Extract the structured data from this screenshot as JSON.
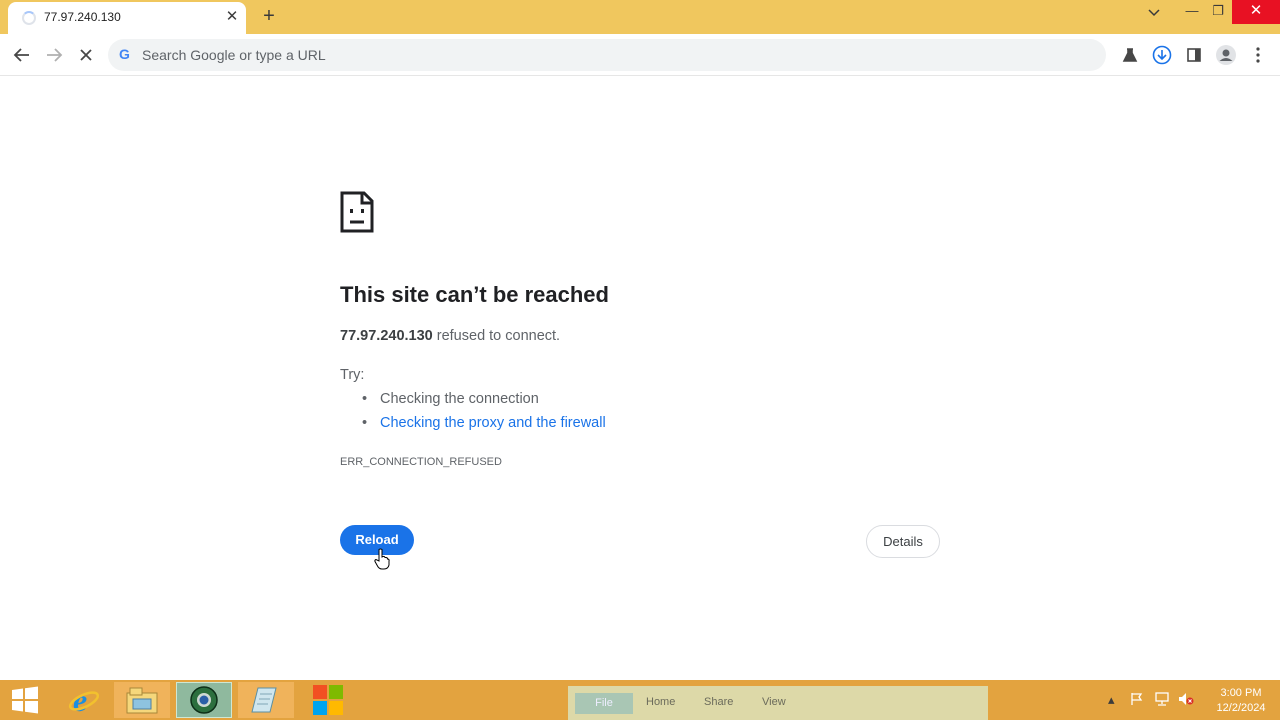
{
  "browser": {
    "tab": {
      "title": "77.97.240.130",
      "close_glyph": "✕"
    },
    "new_tab_glyph": "+",
    "window_controls": {
      "minimize": "—",
      "restore": "❐",
      "close": "✕",
      "dropdown": "⌄"
    },
    "toolbar": {
      "back_icon": "arrow-left-icon",
      "forward_icon": "arrow-right-icon",
      "stop_icon": "stop-icon",
      "omnibox": {
        "placeholder": "Search Google or type a URL",
        "value": "",
        "engine_glyph": "G"
      },
      "right_icons": [
        "extension-icon",
        "download-icon",
        "sidepanel-icon",
        "profile-icon",
        "menu-icon"
      ]
    }
  },
  "error_page": {
    "icon": "sad-document-icon",
    "title": "This site can’t be reached",
    "host": "77.97.240.130",
    "message_suffix": " refused to connect.",
    "try_label": "Try:",
    "suggestions": [
      "Checking the connection",
      "Checking the proxy and the firewall"
    ],
    "error_code": "ERR_CONNECTION_REFUSED",
    "reload_label": "Reload",
    "details_label": "Details",
    "accent_color": "#1a73e8"
  },
  "taskbar": {
    "apps": [
      "windows-logo-icon",
      "internet-explorer-icon",
      "file-explorer-icon",
      "chrome-icon",
      "notepad-icon",
      "microsoft-store-icon"
    ],
    "ribbon_tabs": [
      "File",
      "Home",
      "Share",
      "View"
    ],
    "clock": {
      "time": "3:00 PM",
      "date": "12/2/2024"
    }
  }
}
